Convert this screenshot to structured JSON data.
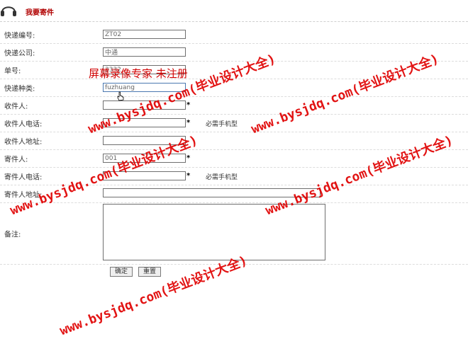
{
  "header": {
    "title": "我要寄件",
    "icon": "headphone-icon"
  },
  "form": {
    "courier_no": {
      "label": "快递编号:",
      "value": "ZT02"
    },
    "courier_company": {
      "label": "快递公司:",
      "value": "中通"
    },
    "tracking_no": {
      "label": "单号:",
      "value": "3332"
    },
    "courier_type": {
      "label": "快递种类:",
      "value": "fuzhuang"
    },
    "receiver": {
      "label": "收件人:",
      "value": "",
      "required": "*"
    },
    "receiver_phone": {
      "label": "收件人电话:",
      "value": "",
      "required": "*",
      "hint": "必需手机型"
    },
    "receiver_addr": {
      "label": "收件人地址:",
      "value": ""
    },
    "sender": {
      "label": "寄件人:",
      "value": "001",
      "required": "*"
    },
    "sender_phone": {
      "label": "寄件人电话:",
      "value": "",
      "required": "*",
      "hint": "必需手机型"
    },
    "sender_addr": {
      "label": "寄件人地址:",
      "value": ""
    },
    "remark": {
      "label": "备注:",
      "value": ""
    }
  },
  "buttons": {
    "confirm": "确定",
    "reset": "重置"
  },
  "watermarks": {
    "site_a": "www.bysjdq.com(毕业设计大全)",
    "site_b": "www.bysjdq.com(毕业设计大全)",
    "site_c": "www.bysjdq.com(毕业设计大全)",
    "site_d": "www.bysjdq.com(毕业设计大全)",
    "site_e": "www.bysjdq.com(毕业设计大全)",
    "recorder": "屏幕录像专家    未注册"
  },
  "colors": {
    "title": "#b00000",
    "watermark": "#e00000",
    "border": "#6f6f6f"
  }
}
